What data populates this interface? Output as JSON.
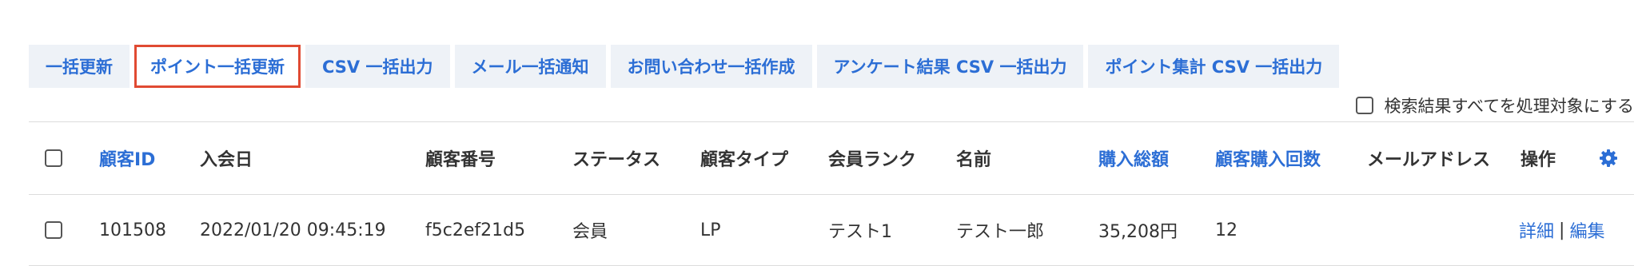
{
  "toolbar": {
    "buttons": [
      {
        "label": "一括更新"
      },
      {
        "label": "ポイント一括更新"
      },
      {
        "label": "CSV 一括出力"
      },
      {
        "label": "メール一括通知"
      },
      {
        "label": "お問い合わせ一括作成"
      },
      {
        "label": "アンケート結果 CSV 一括出力"
      },
      {
        "label": "ポイント集計 CSV 一括出力"
      }
    ],
    "active_index": 1,
    "active_color": "#e04a32",
    "button_bg": "#eef2f7",
    "link_color": "#2c6ed5"
  },
  "select_all_label": "検索結果すべてを処理対象にする",
  "table": {
    "headers": {
      "id": "顧客ID",
      "join_date": "入会日",
      "customer_number": "顧客番号",
      "status": "ステータス",
      "customer_type": "顧客タイプ",
      "member_rank": "会員ランク",
      "name": "名前",
      "total_purchase": "購入総額",
      "purchase_count": "顧客購入回数",
      "email": "メールアドレス",
      "actions": "操作"
    },
    "settings_icon": "gear-icon",
    "rows": [
      {
        "id": "101508",
        "join_date": "2022/01/20 09:45:19",
        "customer_number": "f5c2ef21d5",
        "status": "会員",
        "customer_type": "LP",
        "member_rank": "テスト1",
        "name": "テスト一郎",
        "total_purchase": "35,208円",
        "purchase_count": "12",
        "email": "",
        "action_detail": "詳細",
        "action_sep": "|",
        "action_edit": "編集"
      }
    ]
  }
}
